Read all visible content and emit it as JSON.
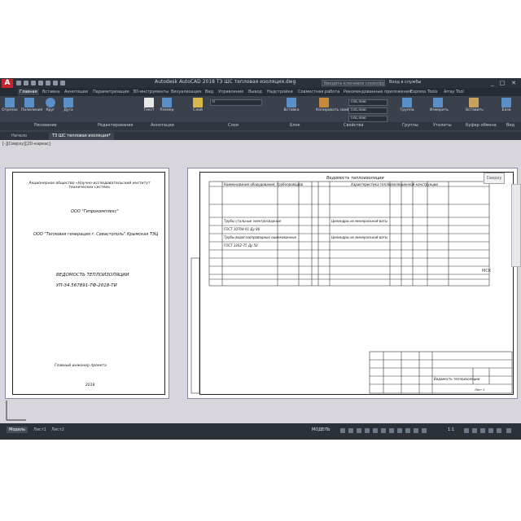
{
  "app": {
    "logo": "A",
    "title": "Autodesk AutoCAD 2018   ТЗ ШС тепловая изоляция.dwg",
    "search_placeholder": "Введите ключевое слово/фразу",
    "user": "Вход в службы",
    "window_controls": [
      "_",
      "□",
      "✕"
    ]
  },
  "ribbon_tabs": [
    "Главная",
    "Вставка",
    "Аннотации",
    "Параметризация",
    "3D-инструменты",
    "Визуализация",
    "Вид",
    "Управление",
    "Вывод",
    "Надстройки",
    "Совместная работа",
    "Рекомендованные приложения",
    "Express Tools",
    "Array Tool"
  ],
  "ribbon_buttons": [
    "Отрезок",
    "Полилиния",
    "Круг",
    "Дуга",
    "Текст",
    "Размер",
    "Слой",
    "Свойства слоя",
    "Вставка",
    "Копировать свойства",
    "Группа",
    "Измерить",
    "Вставить",
    "База"
  ],
  "layer_dropdowns": [
    "0",
    "ПоСлою",
    "ПоСлою",
    "ПоСлою"
  ],
  "panel_labels": [
    "Рисование",
    "Редактирование",
    "Аннотации",
    "Слои",
    "Блок",
    "Свойства",
    "Группы",
    "Утилиты",
    "Буфер обмена",
    "Вид"
  ],
  "file_tabs": [
    "Начало",
    "ТЗ ШС тепловая изоляция*"
  ],
  "viewport_label": "[-][Сверху][2D-каркас]",
  "viewcube": {
    "label": "Сверху",
    "wcs": "МСК"
  },
  "sheet_left": {
    "header": "Акционерное общество «Научно-исследовательский институт технических систем»",
    "org": "ООО \"Гипрокомплекс\"",
    "project": "ООО \"Тепловая генерация г. Севастополь\" Крымская ТЭЦ",
    "doc_title": "ВЕДОМОСТЬ ТЕПЛОИЗОЛЯЦИИ",
    "doc_code": "УП-34.567891-ТФ-2018-ТИ",
    "signature": "Главный инженер проекта",
    "year": "2018"
  },
  "sheet_right": {
    "title": "Ведомость теплоизоляции",
    "col_heads": [
      "Наименование оборудования, трубопроводов",
      "Характеристика теплоизоляционной конструкции"
    ],
    "row1_a": "Трубы стальные электросварные",
    "row1_b": "ГОСТ 10704-91 Ду 80",
    "row1_c": "Цилиндры из минеральной ваты",
    "row2_a": "Трубы водогазопроводные оцинкованные",
    "row2_b": "ГОСТ 3262-75 Ду 50",
    "row2_c": "Цилиндры из минеральной ваты",
    "stamp_title": "Ведомость теплоизоляции",
    "sheet": "Лист 1"
  },
  "status": {
    "tabs": [
      "Модель",
      "Лист1",
      "Лист2"
    ],
    "model": "МОДЕЛЬ",
    "scale": "1:1"
  }
}
